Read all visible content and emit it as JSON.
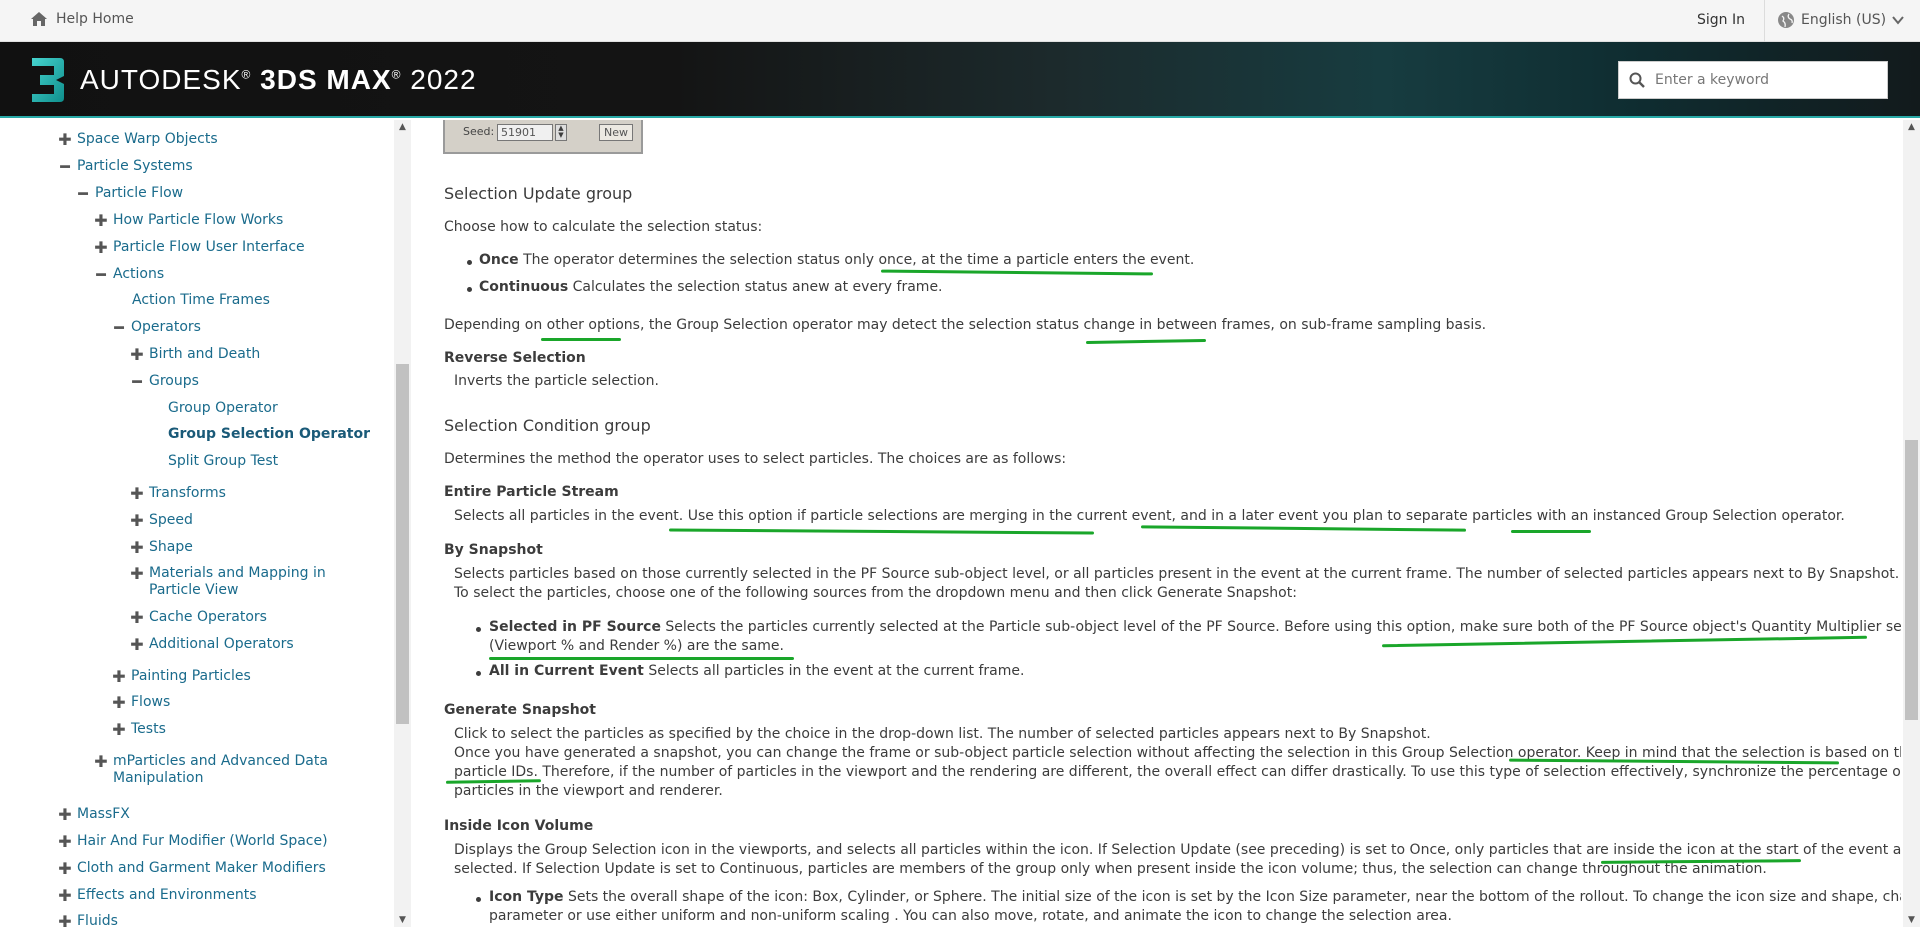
{
  "topbar": {
    "help_home": "Help Home",
    "sign_in": "Sign In",
    "language": "English (US)"
  },
  "brand": {
    "product_name": "AUTODESK® 3DS MAX® 2022",
    "product_prefix": "AUTODESK",
    "product_bold": "3DS MAX",
    "product_year": "2022"
  },
  "search": {
    "placeholder": "Enter a keyword"
  },
  "nav": {
    "space_warp": "Space Warp Objects",
    "particle_systems": "Particle Systems",
    "particle_flow": "Particle Flow",
    "how_pf_works": "How Particle Flow Works",
    "pf_ui": "Particle Flow User Interface",
    "actions": "Actions",
    "action_time_frames": "Action Time Frames",
    "operators": "Operators",
    "birth_death": "Birth and Death",
    "groups": "Groups",
    "group_operator": "Group Operator",
    "group_selection_operator": "Group Selection Operator",
    "split_group_test": "Split Group Test",
    "transforms": "Transforms",
    "speed": "Speed",
    "shape": "Shape",
    "materials_mapping_1": "Materials and Mapping in",
    "materials_mapping_2": "Particle View",
    "cache_operators": "Cache Operators",
    "additional_operators": "Additional Operators",
    "painting_particles": "Painting Particles",
    "flows": "Flows",
    "tests": "Tests",
    "mparticles_1": "mParticles and Advanced Data",
    "mparticles_2": "Manipulation",
    "massfx": "MassFX",
    "hair_fur": "Hair And Fur Modifier (World Space)",
    "cloth": "Cloth and Garment Maker Modifiers",
    "effects": "Effects and Environments",
    "fluids": "Fluids"
  },
  "seed": {
    "label": "Seed:",
    "value": "51901",
    "new_label": "New"
  },
  "content": {
    "selection_update_heading": "Selection Update group",
    "selection_update_intro": "Choose how to calculate the selection status:",
    "once_term": "Once",
    "once_text": "The operator determines the selection status only once, at the time a particle enters the event.",
    "continuous_term": "Continuous",
    "continuous_text": "Calculates the selection status anew at every frame.",
    "depending_text": "Depending on other options, the Group Selection operator may detect the selection status change in between frames, on sub-frame sampling basis.",
    "reverse_selection_term": "Reverse Selection",
    "reverse_selection_text": "Inverts the particle selection.",
    "selection_condition_heading": "Selection Condition group",
    "selection_condition_intro": "Determines the method the operator uses to select particles. The choices are as follows:",
    "entire_stream_term": "Entire Particle Stream",
    "entire_stream_text": "Selects all particles in the event. Use this option if particle selections are merging in the current event, and in a later event you plan to separate particles with an instanced Group Selection operator.",
    "by_snapshot_term": "By Snapshot",
    "by_snapshot_text_1": "Selects particles based on those currently selected in the PF Source sub-object level, or all particles present in the event at the current frame. The number of selected particles appears next to By Snapshot.",
    "by_snapshot_text_2": "To select the particles, choose one of the following sources from the dropdown menu and then click Generate Snapshot:",
    "selected_pf_term": "Selected in PF Source",
    "selected_pf_text_1": "Selects the particles currently selected at the Particle sub-object level of the PF Source. Before using this option, make sure both of the PF Source object's Quantity Multiplier settings",
    "selected_pf_text_2": "(Viewport % and Render %) are the same.",
    "all_current_term": "All in Current Event",
    "all_current_text": "Selects all particles in the event at the current frame.",
    "generate_snapshot_term": "Generate Snapshot",
    "generate_snapshot_text_1": "Click to select the particles as specified by the choice in the drop-down list. The number of selected particles appears next to By Snapshot.",
    "generate_snapshot_text_2": "Once you have generated a snapshot, you can change the frame or sub-object particle selection without affecting the selection in this Group Selection operator. Keep in mind that the selection is based on the",
    "generate_snapshot_text_3": "particle IDs. Therefore, if the number of particles in the viewport and the rendering are different, the overall effect can differ drastically. To use this type of selection effectively, synchronize the percentage of",
    "generate_snapshot_text_4": "particles in the viewport and renderer.",
    "inside_icon_term": "Inside Icon Volume",
    "inside_icon_text_1": "Displays the Group Selection icon in the viewports, and selects all particles within the icon. If Selection Update (see preceding) is set to Once, only particles that are inside the icon at the start of the event are",
    "inside_icon_text_2": "selected. If Selection Update is set to Continuous, particles are members of the group only when present inside the icon volume; thus, the selection can change throughout the animation.",
    "icon_type_term": "Icon Type",
    "icon_type_text_1": "Sets the overall shape of the icon: Box, Cylinder, or Sphere. The initial size of the icon is set by the Icon Size parameter, near the bottom of the rollout. To change the icon size and shape, change this",
    "icon_type_text_2": "parameter or use either uniform and non-uniform scaling . You can also move, rotate, and animate the icon to change the selection area."
  },
  "colors": {
    "link": "#1a6b8c",
    "annotation": "#1aa62a",
    "banner_accent": "#28a9a7"
  },
  "icons": [
    "home-icon",
    "globe-icon",
    "chevron-down-icon",
    "search-icon",
    "expand-icon",
    "collapse-icon"
  ]
}
